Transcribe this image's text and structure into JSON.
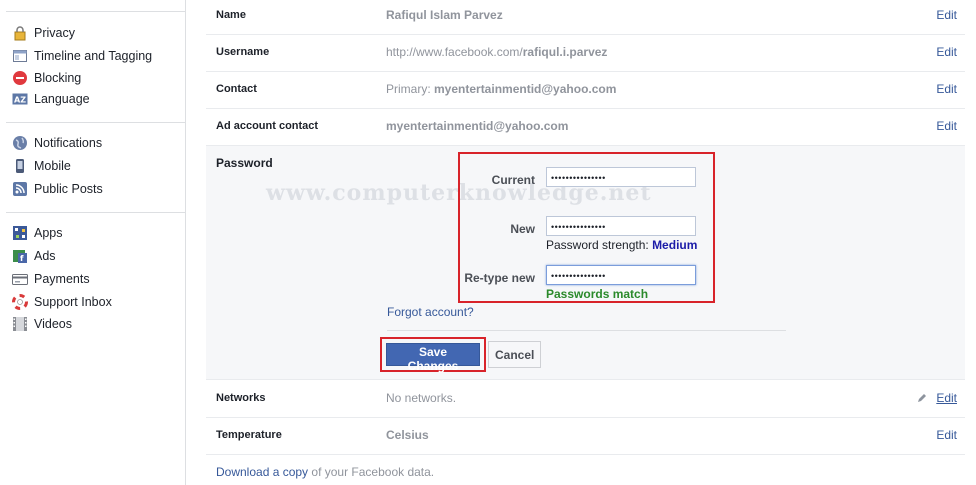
{
  "sidebar": {
    "groups": [
      [
        {
          "label": "Privacy",
          "icon": "lock-icon"
        },
        {
          "label": "Timeline and Tagging",
          "icon": "timeline-icon"
        },
        {
          "label": "Blocking",
          "icon": "block-icon"
        },
        {
          "label": "Language",
          "icon": "language-icon"
        }
      ],
      [
        {
          "label": "Notifications",
          "icon": "globe-icon"
        },
        {
          "label": "Mobile",
          "icon": "mobile-icon"
        },
        {
          "label": "Public Posts",
          "icon": "rss-icon"
        }
      ],
      [
        {
          "label": "Apps",
          "icon": "apps-icon"
        },
        {
          "label": "Ads",
          "icon": "ads-icon"
        },
        {
          "label": "Payments",
          "icon": "payments-icon"
        },
        {
          "label": "Support Inbox",
          "icon": "lifebuoy-icon"
        },
        {
          "label": "Videos",
          "icon": "film-icon"
        }
      ]
    ]
  },
  "settings": {
    "name": {
      "label": "Name",
      "value": "Rafiqul Islam Parvez",
      "edit": "Edit"
    },
    "username": {
      "label": "Username",
      "prefix": "http://www.facebook.com/",
      "value": "rafiqul.i.parvez",
      "edit": "Edit"
    },
    "contact": {
      "label": "Contact",
      "prefix": "Primary: ",
      "value": "myentertainmentid@yahoo.com",
      "edit": "Edit"
    },
    "ad_contact": {
      "label": "Ad account contact",
      "value": "myentertainmentid@yahoo.com",
      "edit": "Edit"
    },
    "networks": {
      "label": "Networks",
      "value": "No networks.",
      "edit": "Edit"
    },
    "temperature": {
      "label": "Temperature",
      "value": "Celsius",
      "edit": "Edit"
    }
  },
  "password": {
    "title": "Password",
    "current_label": "Current",
    "current_value": "•••••••••••••••",
    "new_label": "New",
    "new_value": "•••••••••••••••",
    "strength_prefix": "Password strength: ",
    "strength_value": "Medium",
    "retype_label": "Re-type new",
    "retype_value": "•••••••••••••••",
    "match_text": "Passwords match",
    "forgot": "Forgot account?",
    "save": "Save Changes",
    "cancel": "Cancel",
    "watermark": "www.computerknowledge.net"
  },
  "footer": {
    "link": "Download a copy",
    "rest": " of your Facebook data."
  },
  "colors": {
    "link": "#365899",
    "primary_button": "#4267b2",
    "highlight_box": "#d8232a",
    "match": "#2b8a2b",
    "strength": "#1c1ca8"
  }
}
